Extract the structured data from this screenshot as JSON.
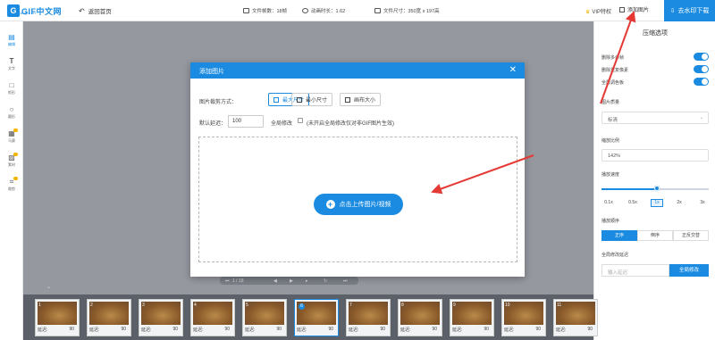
{
  "topbar": {
    "logo_mark": "G",
    "logo_text": "GIF中文网",
    "logo_sub": "www.gif.cn",
    "back_label": "返回首页",
    "frames_stat": "文件帧数：18帧",
    "duration_stat": "动画时长：1.62",
    "size_stat": "文件尺寸：350宽 x 197高",
    "vip_label": "VIP特权",
    "add_image_label": "添加图片",
    "download_label": "去水印下载"
  },
  "tools": [
    {
      "label": "编辑",
      "icon": "edit-icon"
    },
    {
      "label": "文字",
      "icon": "text-icon"
    },
    {
      "label": "矩形",
      "icon": "rectangle-icon"
    },
    {
      "label": "圆形",
      "icon": "circle-icon"
    },
    {
      "label": "马赛",
      "icon": "mosaic-icon"
    },
    {
      "label": "素材",
      "icon": "sticker-icon"
    },
    {
      "label": "裁剪",
      "icon": "crop-icon"
    }
  ],
  "panel": {
    "title": "压缩选项",
    "toggle1": "删除多余帧",
    "toggle2": "删除重复像素",
    "toggle3": "全局调色板",
    "quality_label": "图片质量",
    "quality_value": "标清",
    "scale_label": "缩放比例",
    "scale_value": "142%",
    "speed_label": "播放速度",
    "speeds": [
      "0.1x",
      "0.5x",
      "1x",
      "2x",
      "3x"
    ],
    "speed_active": "1x",
    "speed_fraction": 0.52,
    "order_label": "播放顺序",
    "orders": [
      "正序",
      "倒序",
      "正反交替"
    ],
    "delay_label": "全局修改延迟",
    "delay_placeholder": "输入延迟",
    "delay_button": "全局修改"
  },
  "timeline": {
    "page": "1 / 18",
    "collapse": "⌄"
  },
  "frames": [
    {
      "num": "1",
      "delay_label": "延迟:",
      "delay": "90"
    },
    {
      "num": "2",
      "delay_label": "延迟:",
      "delay": "90"
    },
    {
      "num": "3",
      "delay_label": "延迟:",
      "delay": "90"
    },
    {
      "num": "4",
      "delay_label": "延迟:",
      "delay": "90"
    },
    {
      "num": "5",
      "delay_label": "延迟:",
      "delay": "90"
    },
    {
      "num": "6",
      "delay_label": "延迟:",
      "delay": "90"
    },
    {
      "num": "7",
      "delay_label": "延迟:",
      "delay": "90"
    },
    {
      "num": "8",
      "delay_label": "延迟:",
      "delay": "90"
    },
    {
      "num": "9",
      "delay_label": "延迟:",
      "delay": "90"
    },
    {
      "num": "10",
      "delay_label": "延迟:",
      "delay": "90"
    },
    {
      "num": "11",
      "delay_label": "延迟:",
      "delay": "90"
    }
  ],
  "modal": {
    "title": "添加图片",
    "close": "✕",
    "crop_label": "图片裁剪方式：",
    "crop_options": [
      "最大尺寸",
      "最小尺寸",
      "画布大小"
    ],
    "crop_active": "最大尺寸",
    "delay_label": "默认延迟：",
    "delay_value": "100",
    "global_label": "全局修改",
    "hint": "(未开启全局修改仅对非GIF图片生效)",
    "upload_label": "点击上传图片/视频"
  },
  "colors": {
    "accent": "#1a8be0",
    "annotation": "#e53935"
  }
}
